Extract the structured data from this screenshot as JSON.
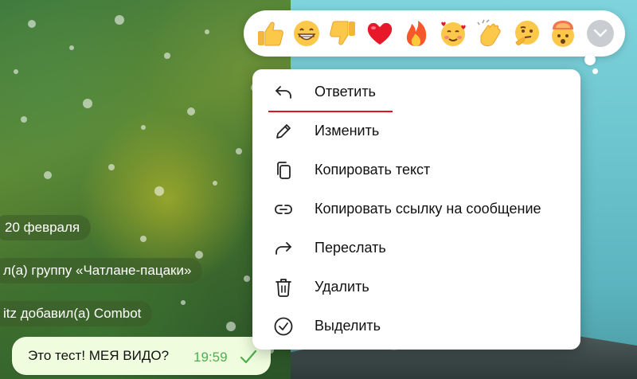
{
  "chat": {
    "service_date": "20 февраля",
    "service_group": "л(а) группу «Чатлане-пацаки»",
    "service_added": "itz добавил(а) Combot",
    "message": {
      "text": "Это тест! МЕЯ ВИДО?",
      "time": "19:59",
      "status_icon": "double-check-icon"
    }
  },
  "reactions": [
    {
      "name": "thumbs-up",
      "glyph": "👍"
    },
    {
      "name": "grin",
      "glyph": "😁"
    },
    {
      "name": "thumbs-down",
      "glyph": "👎"
    },
    {
      "name": "heart",
      "glyph": "❤️"
    },
    {
      "name": "fire",
      "glyph": "🔥"
    },
    {
      "name": "smiling-hearts",
      "glyph": "🥰"
    },
    {
      "name": "clap",
      "glyph": "👏"
    },
    {
      "name": "thinking",
      "glyph": "🤔"
    },
    {
      "name": "mind-blown",
      "glyph": "🤯"
    }
  ],
  "context_menu": {
    "items": [
      {
        "label": "Ответить",
        "icon": "reply-icon"
      },
      {
        "label": "Изменить",
        "icon": "pencil-icon"
      },
      {
        "label": "Копировать текст",
        "icon": "copy-icon"
      },
      {
        "label": "Копировать ссылку на сообщение",
        "icon": "link-icon"
      },
      {
        "label": "Переслать",
        "icon": "forward-icon"
      },
      {
        "label": "Удалить",
        "icon": "trash-icon"
      },
      {
        "label": "Выделить",
        "icon": "check-circle-icon"
      }
    ]
  },
  "colors": {
    "menu_bg": "#ffffff",
    "highlight_underline": "#e0141e",
    "outgoing_bubble": "#effdde",
    "time_green": "#4fae4e"
  }
}
